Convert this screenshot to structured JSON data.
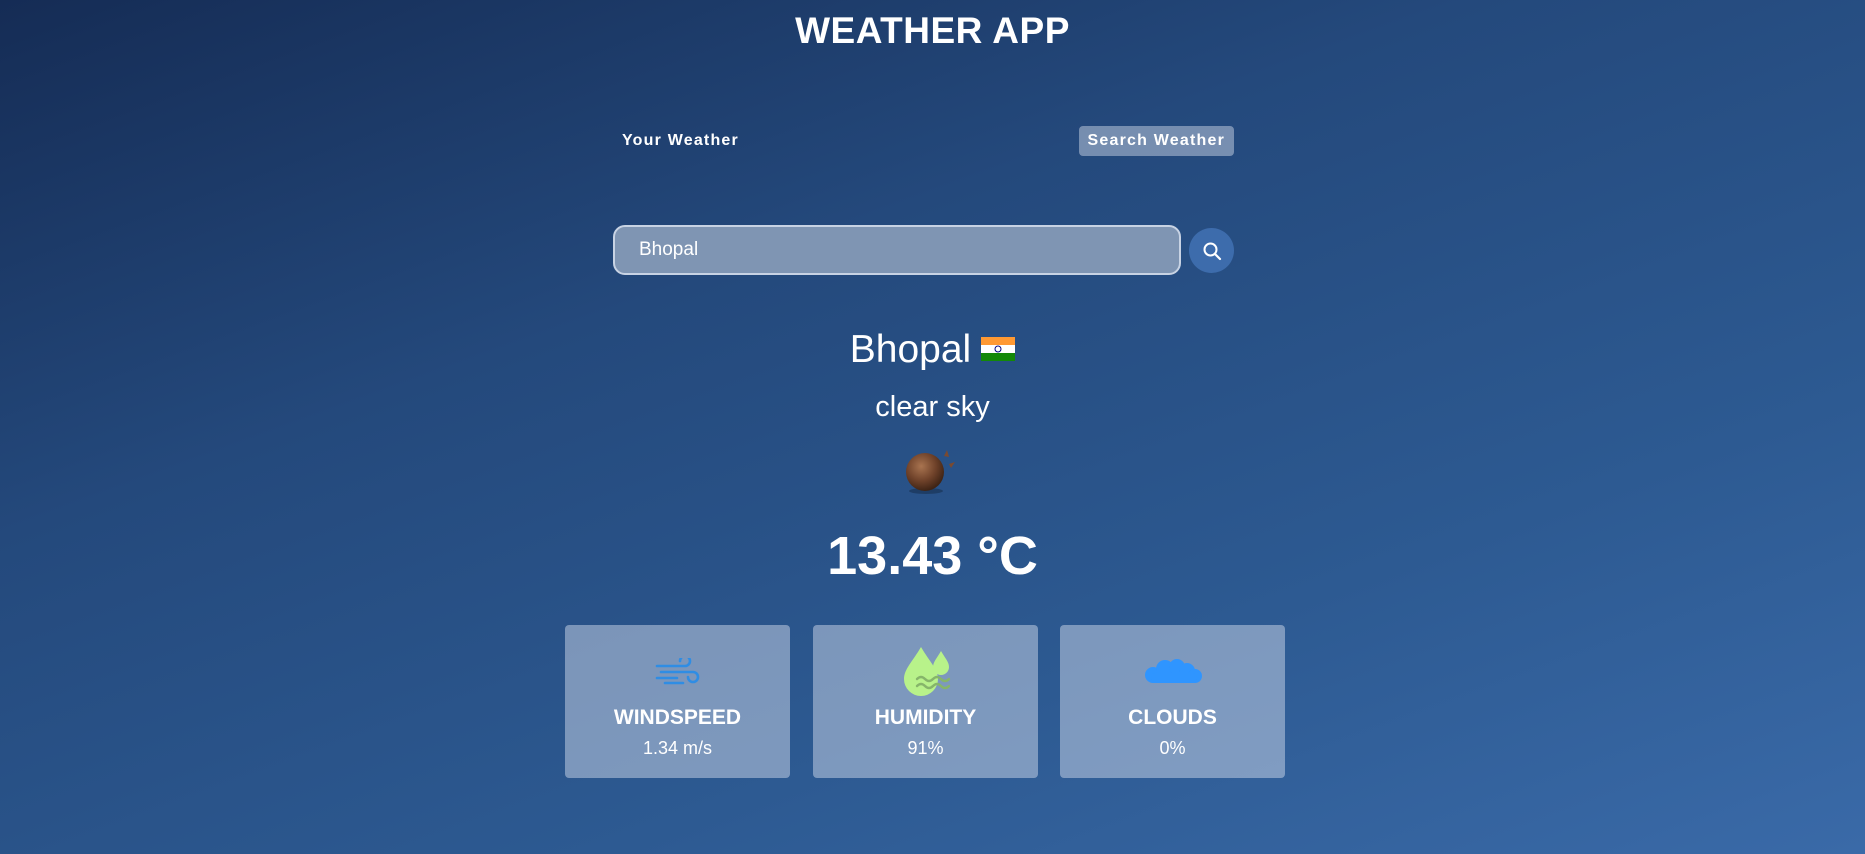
{
  "app": {
    "title": "WEATHER APP"
  },
  "tabs": {
    "your_weather": "Your Weather",
    "search_weather": "Search Weather",
    "active": "search_weather"
  },
  "search": {
    "value": "Bhopal",
    "placeholder": "Search for city...",
    "icon": "search-icon"
  },
  "weather": {
    "city": "Bhopal",
    "country_flag": "india-flag-icon",
    "description": "clear sky",
    "condition_icon": "clear-sky-icon",
    "temperature": "13.43 °C"
  },
  "stats": [
    {
      "icon": "wind-icon",
      "label": "WINDSPEED",
      "value": "1.34 m/s"
    },
    {
      "icon": "humidity-icon",
      "label": "HUMIDITY",
      "value": "91%"
    },
    {
      "icon": "clouds-icon",
      "label": "CLOUDS",
      "value": "0%"
    }
  ],
  "colors": {
    "background_start": "#152c55",
    "background_end": "#3a6aa8",
    "search_button": "#3d6cac",
    "wind_icon": "#2f8de4",
    "humidity_icon": "#b8f28a",
    "clouds_icon": "#2f95ff"
  }
}
